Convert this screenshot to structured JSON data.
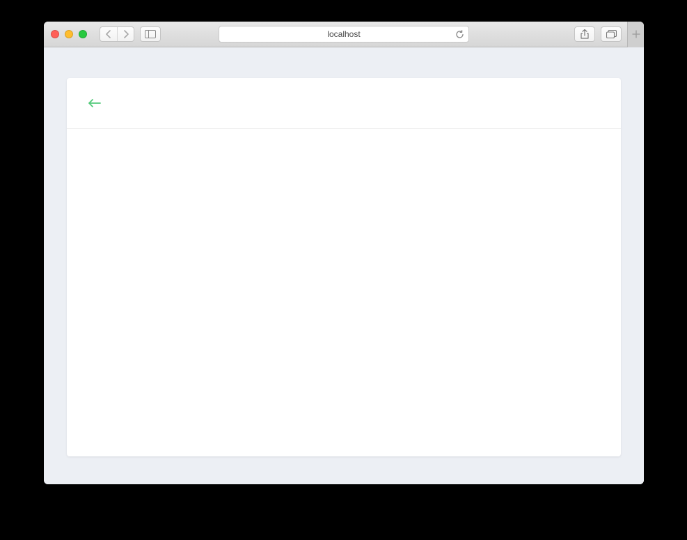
{
  "browser": {
    "address": "localhost"
  },
  "colors": {
    "accent_green": "#52c97a",
    "page_bg": "#eceff4"
  },
  "card": {
    "header": {},
    "body": {}
  }
}
